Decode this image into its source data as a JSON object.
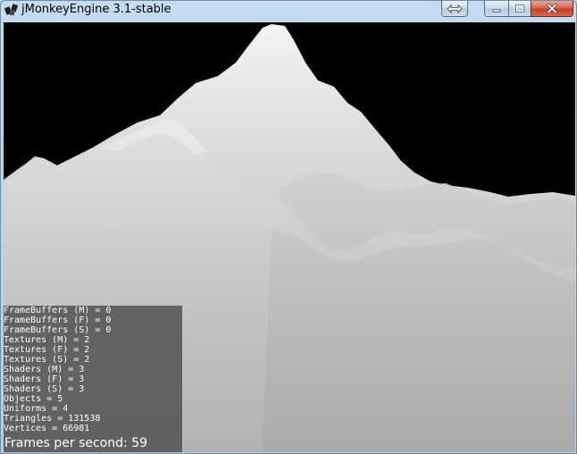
{
  "window": {
    "title": "jMonkeyEngine 3.1-stable"
  },
  "icons": {
    "app": "jmonkey-logo-icon",
    "restore": "restore-arrows-icon",
    "minimize": "minimize-icon",
    "maximize": "maximize-icon",
    "close": "close-icon"
  },
  "stats": {
    "lines": [
      "FrameBuffers (M) = 0",
      "FrameBuffers (F) = 0",
      "FrameBuffers (S) = 0",
      "Textures (M) = 2",
      "Textures (F) = 2",
      "Textures (S) = 2",
      "Shaders (M) = 3",
      "Shaders (F) = 3",
      "Shaders (S) = 3",
      "Objects = 5",
      "Uniforms = 4",
      "Triangles = 131538",
      "Vertices = 66981"
    ],
    "fps": "Frames per second: 59"
  },
  "colors": {
    "sky": "#000000",
    "terrain_peak": "#f2f2f2",
    "terrain_far": "#c8c8c8",
    "stats_bg": "#5a5a5a",
    "text": "#ffffff"
  }
}
